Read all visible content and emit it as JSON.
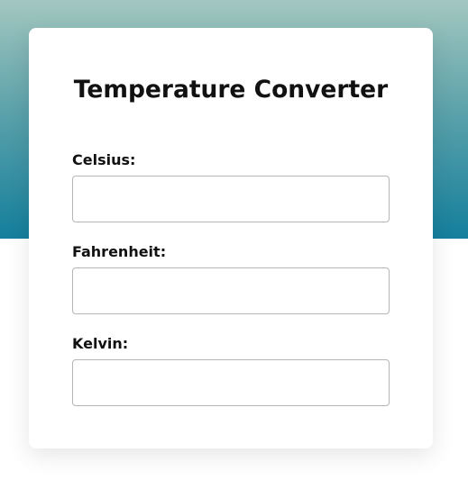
{
  "converter": {
    "title": "Temperature Converter",
    "fields": [
      {
        "label": "Celsius:",
        "value": ""
      },
      {
        "label": "Fahrenheit:",
        "value": ""
      },
      {
        "label": "Kelvin:",
        "value": ""
      }
    ]
  },
  "colors": {
    "banner_top": "#a3c7c0",
    "banner_bottom": "#147f9c",
    "card_background": "#ffffff",
    "input_border": "#b5b5b5",
    "text": "#111111"
  }
}
